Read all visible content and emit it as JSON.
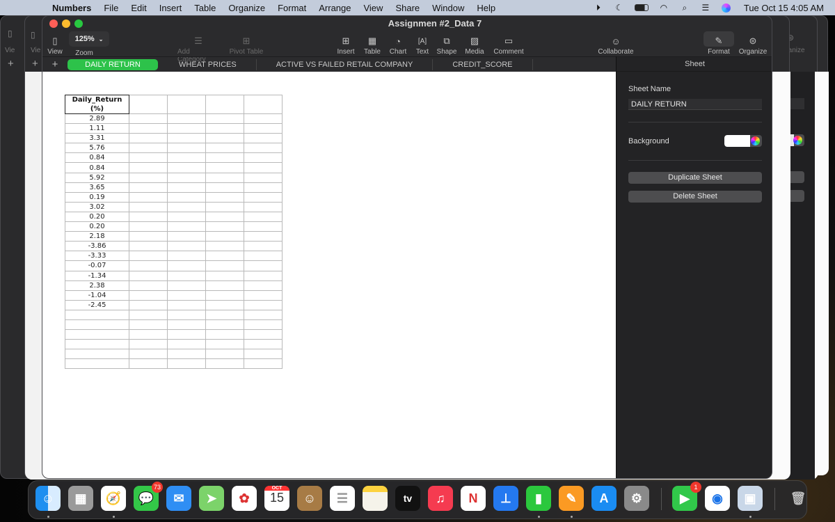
{
  "menubar": {
    "app_name": "Numbers",
    "items": [
      "File",
      "Edit",
      "Insert",
      "Table",
      "Organize",
      "Format",
      "Arrange",
      "View",
      "Share",
      "Window",
      "Help"
    ],
    "status_icons": [
      "play-circle-icon",
      "moon-icon",
      "battery-icon",
      "wifi-icon",
      "search-icon",
      "control-center-icon",
      "siri-icon"
    ],
    "clock": "Tue Oct 15  4:05 AM"
  },
  "window": {
    "title": "Assignmen #2_Data 7",
    "toolbar": {
      "view": "View",
      "zoom_value": "125%",
      "zoom": "Zoom",
      "add_category": "Add Category",
      "pivot_table": "Pivot Table",
      "insert": "Insert",
      "table": "Table",
      "chart": "Chart",
      "text": "Text",
      "shape": "Shape",
      "media": "Media",
      "comment": "Comment",
      "collaborate": "Collaborate",
      "format": "Format",
      "organize": "Organize"
    },
    "sheet_tabs": [
      {
        "label": "DAILY RETURN",
        "active": true
      },
      {
        "label": "WHEAT PRICES",
        "active": false
      },
      {
        "label": "ACTIVE VS FAILED RETAIL COMPANY",
        "active": false
      },
      {
        "label": "CREDIT_SCORE",
        "active": false
      }
    ],
    "table": {
      "header": "Daily_Return (%)",
      "values": [
        "2.89",
        "1.11",
        "3.31",
        "5.76",
        "0.84",
        "0.84",
        "5.92",
        "3.65",
        "0.19",
        "3.02",
        "0.20",
        "0.20",
        "2.18",
        "-3.86",
        "-3.33",
        "-0.07",
        "-1.34",
        "2.38",
        "-1.04",
        "-2.45",
        "",
        "",
        "",
        "",
        "",
        ""
      ]
    },
    "inspector": {
      "title": "Sheet",
      "sheet_name_label": "Sheet Name",
      "sheet_name_value": "DAILY RETURN",
      "background_label": "Background",
      "background_color": "#ffffff",
      "duplicate_button": "Duplicate Sheet",
      "delete_button": "Delete Sheet"
    }
  },
  "background_windows": {
    "view_label": "Vie",
    "organize_label": "Organize",
    "format_partial": "t"
  },
  "dock": {
    "apps": [
      {
        "name": "Finder",
        "icon": "finder-icon",
        "running": true
      },
      {
        "name": "Launchpad",
        "icon": "launchpad-icon"
      },
      {
        "name": "Safari",
        "icon": "safari-icon",
        "running": true
      },
      {
        "name": "Messages",
        "icon": "messages-icon",
        "badge": "73"
      },
      {
        "name": "Mail",
        "icon": "mail-icon"
      },
      {
        "name": "Maps",
        "icon": "maps-icon"
      },
      {
        "name": "Photos",
        "icon": "photos-icon"
      },
      {
        "name": "Calendar",
        "icon": "calendar-icon",
        "month": "OCT",
        "day": "15"
      },
      {
        "name": "Contacts",
        "icon": "contacts-icon"
      },
      {
        "name": "Reminders",
        "icon": "reminders-icon"
      },
      {
        "name": "Notes",
        "icon": "notes-icon"
      },
      {
        "name": "TV",
        "icon": "apple-tv-icon",
        "label": "tv"
      },
      {
        "name": "Music",
        "icon": "music-icon"
      },
      {
        "name": "News",
        "icon": "news-icon"
      },
      {
        "name": "Keynote",
        "icon": "keynote-icon"
      },
      {
        "name": "Numbers",
        "icon": "numbers-icon",
        "running": true
      },
      {
        "name": "Pages",
        "icon": "pages-icon",
        "running": true
      },
      {
        "name": "App Store",
        "icon": "app-store-icon"
      },
      {
        "name": "System Preferences",
        "icon": "system-preferences-icon"
      },
      {
        "name": "FaceTime",
        "icon": "facetime-icon",
        "badge": "1"
      },
      {
        "name": "Chrome",
        "icon": "chrome-icon"
      },
      {
        "name": "Preview",
        "icon": "preview-icon",
        "running": true
      },
      {
        "name": "Trash",
        "icon": "trash-icon"
      }
    ]
  }
}
